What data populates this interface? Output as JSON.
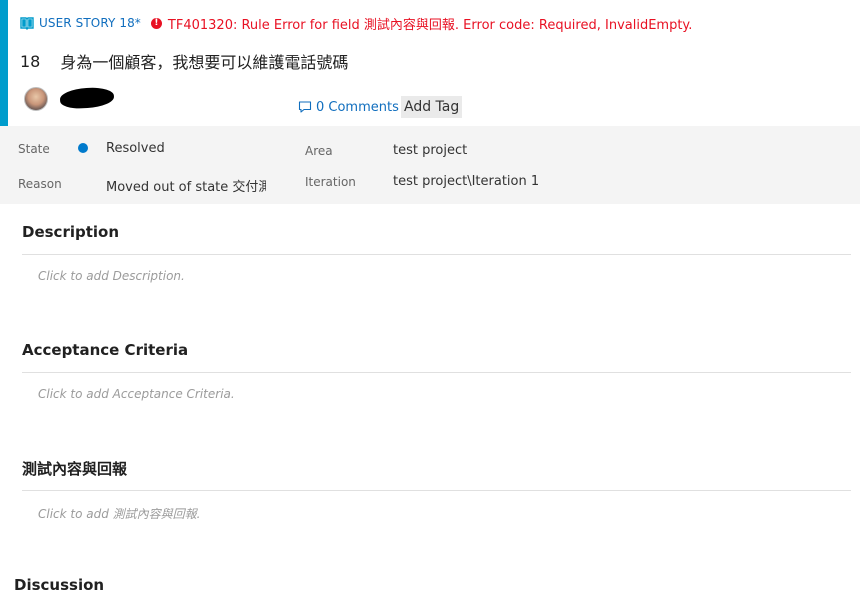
{
  "header": {
    "work_item_type": "USER STORY 18*",
    "error_message": "TF401320: Rule Error for field 測試內容與回報. Error code: Required, InvalidEmpty.",
    "id": "18",
    "title": "身為一個顧客，我想要可以維護電話號碼",
    "comments_label": "0 Comments",
    "add_tag_label": "Add Tag",
    "accent_color": "#009ccc",
    "error_color": "#e81123"
  },
  "fields": {
    "state_label": "State",
    "state_value": "Resolved",
    "state_color": "#007acc",
    "reason_label": "Reason",
    "reason_value": "Moved out of state 交付測",
    "area_label": "Area",
    "area_value": "test project",
    "iteration_label": "Iteration",
    "iteration_value": "test project\\Iteration 1"
  },
  "sections": [
    {
      "title": "Description",
      "placeholder": "Click to add Description."
    },
    {
      "title": "Acceptance Criteria",
      "placeholder": "Click to add Acceptance Criteria."
    },
    {
      "title": "測試內容與回報",
      "placeholder": "Click to add 測試內容與回報."
    }
  ],
  "discussion": {
    "title": "Discussion"
  }
}
